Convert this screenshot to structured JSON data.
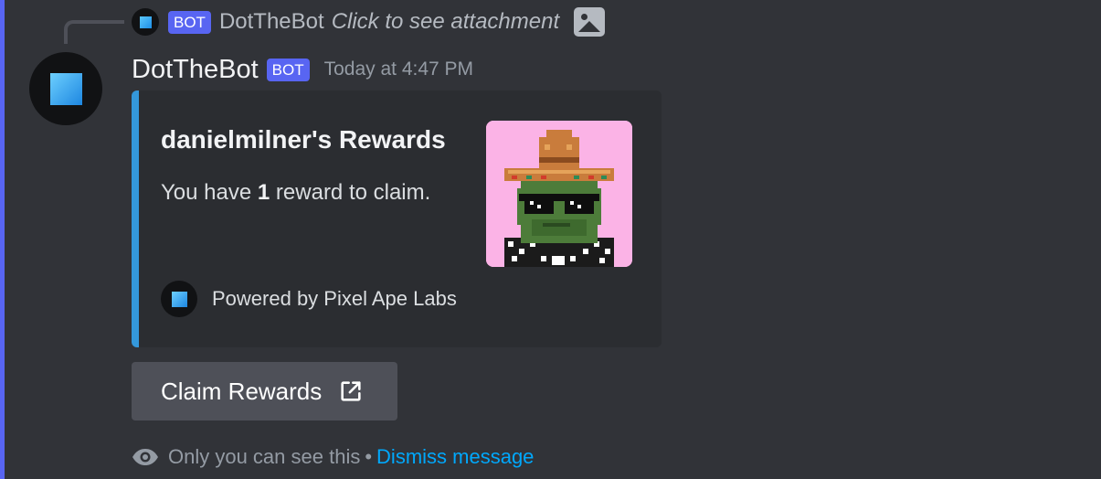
{
  "reply": {
    "bot_tag": "BOT",
    "author": "DotTheBot",
    "text": "Click to see attachment",
    "attachment_icon": "image-icon"
  },
  "message": {
    "author": "DotTheBot",
    "bot_tag": "BOT",
    "timestamp": "Today at 4:47 PM"
  },
  "embed": {
    "accent_color": "#3498db",
    "title": "danielmilner's Rewards",
    "description_prefix": "You have ",
    "description_count": "1",
    "description_suffix": " reward to claim.",
    "thumbnail": "pixel-ape-sombrero-image",
    "footer_text": "Powered by Pixel Ape Labs"
  },
  "button": {
    "label": "Claim Rewards",
    "icon": "external-link-icon"
  },
  "ephemeral": {
    "notice": "Only you can see this",
    "separator": "•",
    "dismiss_label": "Dismiss message"
  },
  "colors": {
    "background": "#313338",
    "bot_tag": "#5865f2",
    "link": "#00a8fc"
  }
}
